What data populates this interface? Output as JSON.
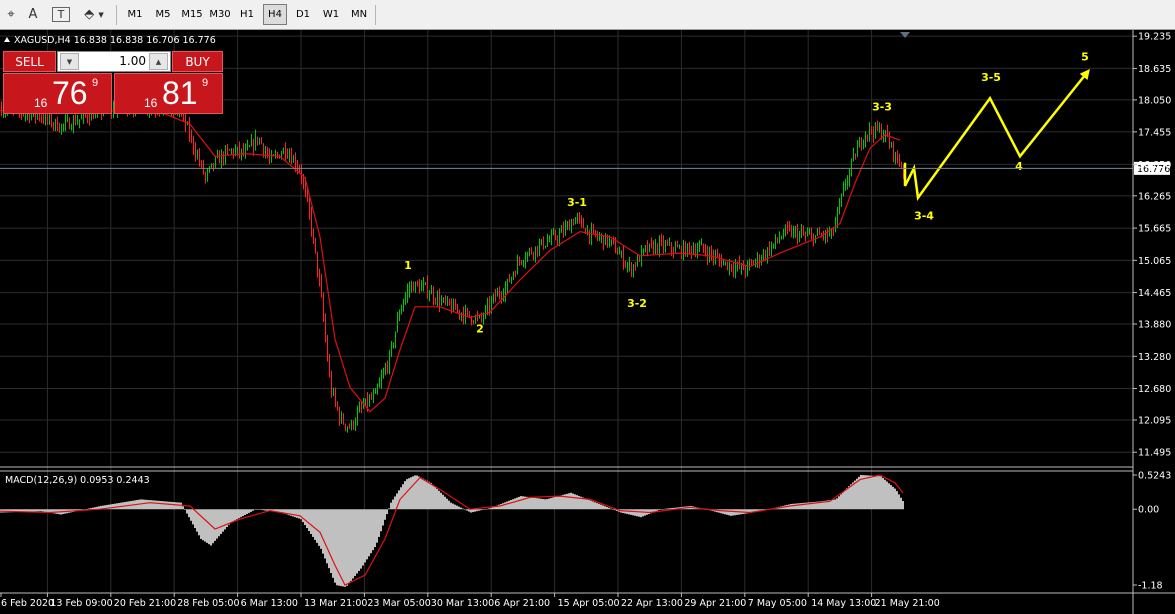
{
  "toolbar": {
    "icons": [
      "crosshair-icon",
      "text-icon",
      "text-label-icon",
      "shapes-icon"
    ],
    "icon_glyphs": [
      "⌖",
      "A",
      "T",
      "⬘"
    ],
    "timeframes": [
      "M1",
      "M5",
      "M15",
      "M30",
      "H1",
      "H4",
      "D1",
      "W1",
      "MN"
    ],
    "active_timeframe": "H4"
  },
  "chart_header": {
    "text": "XAGUSD,H4  16.838 16.838 16.706 16.776"
  },
  "trade_panel": {
    "sell_label": "SELL",
    "buy_label": "BUY",
    "lot": "1.00",
    "sell_price": {
      "prefix": "16",
      "main": "76",
      "sup": "9"
    },
    "buy_price": {
      "prefix": "16",
      "main": "81",
      "sup": "9"
    }
  },
  "colors": {
    "bull_candle": "#00c800",
    "bear_candle": "#ff2020",
    "ma_line": "#e01010",
    "annotation": "#ffff00",
    "grid": "#2c2c2c",
    "macd_hist": "#c0c0c0",
    "macd_signal": "#e01010"
  },
  "chart_data": {
    "type": "candlestick",
    "symbol": "XAGUSD",
    "timeframe": "H4",
    "ohlc_current": {
      "open": 16.838,
      "high": 16.838,
      "low": 16.706,
      "close": 16.776
    },
    "current_price": "16.776",
    "ylim": [
      11.22,
      19.35
    ],
    "y_ticks": [
      "19.235",
      "18.635",
      "18.050",
      "17.455",
      "16.850",
      "16.265",
      "15.665",
      "15.065",
      "14.465",
      "13.880",
      "13.280",
      "12.680",
      "12.095",
      "11.495"
    ],
    "x_ticks": [
      "6 Feb 2020",
      "13 Feb 09:00",
      "20 Feb 21:00",
      "28 Feb 05:00",
      "6 Mar 13:00",
      "13 Mar 21:00",
      "23 Mar 05:00",
      "30 Mar 13:00",
      "6 Apr 21:00",
      "15 Apr 05:00",
      "22 Apr 13:00",
      "29 Apr 21:00",
      "7 May 05:00",
      "14 May 13:00",
      "21 May 21:00"
    ],
    "price_path": [
      [
        0,
        17.9
      ],
      [
        40,
        17.75
      ],
      [
        60,
        17.55
      ],
      [
        100,
        17.85
      ],
      [
        140,
        17.95
      ],
      [
        180,
        17.85
      ],
      [
        195,
        17.1
      ],
      [
        205,
        16.6
      ],
      [
        215,
        16.9
      ],
      [
        230,
        17.1
      ],
      [
        245,
        17.05
      ],
      [
        258,
        17.35
      ],
      [
        270,
        16.9
      ],
      [
        285,
        17.15
      ],
      [
        300,
        16.75
      ],
      [
        310,
        15.8
      ],
      [
        320,
        14.5
      ],
      [
        330,
        12.7
      ],
      [
        340,
        12.1
      ],
      [
        350,
        11.95
      ],
      [
        360,
        12.3
      ],
      [
        375,
        12.55
      ],
      [
        390,
        13.3
      ],
      [
        400,
        14.2
      ],
      [
        410,
        14.6
      ],
      [
        425,
        14.55
      ],
      [
        440,
        14.3
      ],
      [
        460,
        14.1
      ],
      [
        480,
        13.95
      ],
      [
        495,
        14.4
      ],
      [
        505,
        14.55
      ],
      [
        520,
        15.1
      ],
      [
        540,
        15.35
      ],
      [
        560,
        15.55
      ],
      [
        575,
        15.85
      ],
      [
        590,
        15.55
      ],
      [
        610,
        15.4
      ],
      [
        630,
        14.9
      ],
      [
        645,
        15.25
      ],
      [
        660,
        15.35
      ],
      [
        680,
        15.25
      ],
      [
        700,
        15.3
      ],
      [
        712,
        15.15
      ],
      [
        725,
        15.0
      ],
      [
        745,
        14.9
      ],
      [
        765,
        15.2
      ],
      [
        785,
        15.6
      ],
      [
        810,
        15.5
      ],
      [
        832,
        15.55
      ],
      [
        845,
        16.5
      ],
      [
        855,
        17.05
      ],
      [
        865,
        17.45
      ],
      [
        875,
        17.5
      ],
      [
        885,
        17.4
      ],
      [
        895,
        17.0
      ],
      [
        903,
        16.78
      ]
    ],
    "ma_path": [
      [
        0,
        17.85
      ],
      [
        80,
        17.8
      ],
      [
        150,
        17.9
      ],
      [
        190,
        17.6
      ],
      [
        215,
        17.0
      ],
      [
        245,
        17.05
      ],
      [
        280,
        17.0
      ],
      [
        305,
        16.6
      ],
      [
        320,
        15.5
      ],
      [
        335,
        13.6
      ],
      [
        350,
        12.7
      ],
      [
        370,
        12.25
      ],
      [
        385,
        12.5
      ],
      [
        400,
        13.4
      ],
      [
        415,
        14.2
      ],
      [
        440,
        14.2
      ],
      [
        470,
        14.0
      ],
      [
        490,
        14.1
      ],
      [
        520,
        14.7
      ],
      [
        550,
        15.25
      ],
      [
        580,
        15.6
      ],
      [
        610,
        15.5
      ],
      [
        640,
        15.15
      ],
      [
        680,
        15.2
      ],
      [
        710,
        15.15
      ],
      [
        750,
        14.95
      ],
      [
        780,
        15.2
      ],
      [
        820,
        15.5
      ],
      [
        840,
        15.75
      ],
      [
        855,
        16.5
      ],
      [
        870,
        17.15
      ],
      [
        885,
        17.4
      ],
      [
        900,
        17.3
      ]
    ],
    "wave_labels": [
      {
        "label": "1",
        "x": 408,
        "price": 14.9
      },
      {
        "label": "2",
        "x": 480,
        "price": 13.72
      },
      {
        "label": "3-1",
        "x": 577,
        "price": 16.08
      },
      {
        "label": "3-2",
        "x": 637,
        "price": 14.2
      },
      {
        "label": "3-3",
        "x": 882,
        "price": 17.85
      },
      {
        "label": "3-4",
        "x": 924,
        "price": 15.82
      },
      {
        "label": "3-5",
        "x": 991,
        "price": 18.4
      },
      {
        "label": "4",
        "x": 1019,
        "price": 16.75
      },
      {
        "label": "5",
        "x": 1085,
        "price": 18.78
      }
    ],
    "projection": [
      [
        905,
        16.88
      ],
      [
        905,
        16.45
      ],
      [
        914,
        16.78
      ],
      [
        918,
        16.23
      ],
      [
        990,
        18.08
      ],
      [
        1020,
        17.0
      ],
      [
        1088,
        18.58
      ]
    ],
    "macd": {
      "label": "MACD(12,26,9) 0.0953 0.2443",
      "y_ticks": [
        "0.5243",
        "0.00",
        "-1.18"
      ],
      "ylim": [
        -1.27,
        0.58
      ],
      "hist_path": [
        [
          0,
          -0.05
        ],
        [
          40,
          -0.03
        ],
        [
          60,
          -0.08
        ],
        [
          100,
          0.05
        ],
        [
          140,
          0.15
        ],
        [
          180,
          0.1
        ],
        [
          200,
          -0.45
        ],
        [
          210,
          -0.55
        ],
        [
          230,
          -0.2
        ],
        [
          255,
          0.0
        ],
        [
          280,
          -0.05
        ],
        [
          300,
          -0.15
        ],
        [
          320,
          -0.6
        ],
        [
          335,
          -1.15
        ],
        [
          345,
          -1.18
        ],
        [
          360,
          -0.9
        ],
        [
          375,
          -0.55
        ],
        [
          390,
          0.1
        ],
        [
          405,
          0.45
        ],
        [
          415,
          0.52
        ],
        [
          430,
          0.4
        ],
        [
          450,
          0.1
        ],
        [
          470,
          -0.05
        ],
        [
          490,
          0.02
        ],
        [
          520,
          0.2
        ],
        [
          545,
          0.15
        ],
        [
          570,
          0.25
        ],
        [
          595,
          0.1
        ],
        [
          620,
          -0.05
        ],
        [
          640,
          -0.12
        ],
        [
          660,
          0.0
        ],
        [
          690,
          0.05
        ],
        [
          710,
          -0.02
        ],
        [
          730,
          -0.1
        ],
        [
          760,
          -0.03
        ],
        [
          790,
          0.08
        ],
        [
          820,
          0.12
        ],
        [
          835,
          0.15
        ],
        [
          848,
          0.35
        ],
        [
          860,
          0.52
        ],
        [
          880,
          0.5
        ],
        [
          895,
          0.3
        ],
        [
          903,
          0.1
        ]
      ],
      "signal_path": [
        [
          0,
          -0.03
        ],
        [
          50,
          -0.05
        ],
        [
          100,
          0.0
        ],
        [
          150,
          0.1
        ],
        [
          190,
          0.05
        ],
        [
          215,
          -0.3
        ],
        [
          240,
          -0.15
        ],
        [
          270,
          -0.02
        ],
        [
          300,
          -0.1
        ],
        [
          320,
          -0.35
        ],
        [
          335,
          -0.85
        ],
        [
          345,
          -1.15
        ],
        [
          365,
          -1.0
        ],
        [
          385,
          -0.45
        ],
        [
          400,
          0.15
        ],
        [
          420,
          0.48
        ],
        [
          440,
          0.3
        ],
        [
          470,
          0.0
        ],
        [
          500,
          0.05
        ],
        [
          530,
          0.18
        ],
        [
          560,
          0.2
        ],
        [
          590,
          0.15
        ],
        [
          620,
          -0.02
        ],
        [
          650,
          -0.05
        ],
        [
          690,
          0.03
        ],
        [
          720,
          -0.02
        ],
        [
          750,
          -0.05
        ],
        [
          790,
          0.05
        ],
        [
          830,
          0.12
        ],
        [
          860,
          0.45
        ],
        [
          880,
          0.52
        ],
        [
          895,
          0.4
        ],
        [
          903,
          0.25
        ]
      ]
    }
  }
}
